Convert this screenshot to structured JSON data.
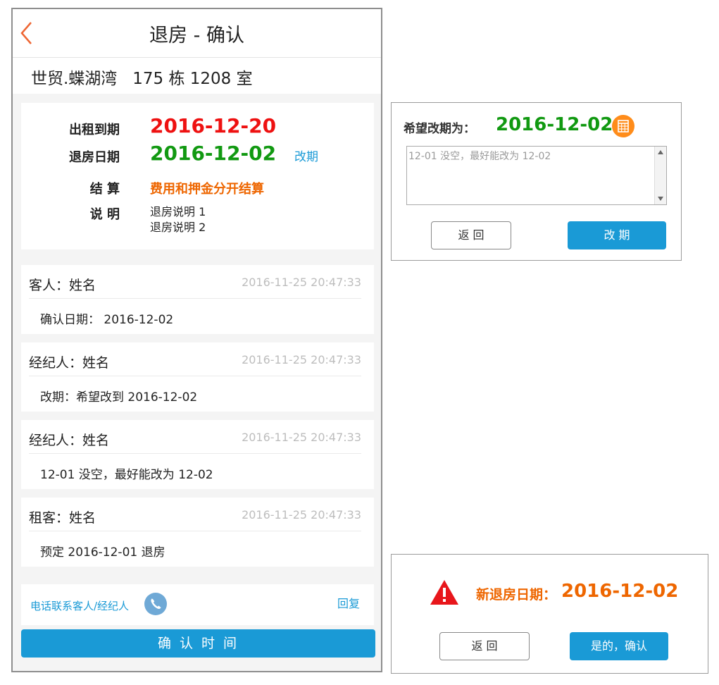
{
  "header": {
    "title": "退房 - 确认"
  },
  "address": "世贸.蝶湖湾   175 栋 1208 室",
  "info": {
    "lease_end_label": "出租到期",
    "lease_end_value": "2016-12-20",
    "checkout_label": "退房日期",
    "checkout_value": "2016-12-02",
    "change_link": "改期",
    "settle_label": "结 算",
    "settle_value": "费用和押金分开结算",
    "note_label": "说 明",
    "notes": [
      "退房说明 1",
      "退房说明 2"
    ]
  },
  "messages": [
    {
      "who": "客人：姓名",
      "time": "2016-11-25 20:47:33",
      "body": "确认日期： 2016-12-02"
    },
    {
      "who": "经纪人：姓名",
      "time": "2016-11-25 20:47:33",
      "body": "改期：希望改到 2016-12-02"
    },
    {
      "who": "经纪人：姓名",
      "time": "2016-11-25 20:47:33",
      "body": "12-01 没空，最好能改为 12-02"
    },
    {
      "who": "租客：姓名",
      "time": "2016-11-25 20:47:33",
      "body": "预定 2016-12-01 退房"
    }
  ],
  "footer": {
    "call_label": "电话联系客人/经纪人",
    "reply_label": "回复"
  },
  "confirm_button": "确 认 时 间",
  "reschedule_dialog": {
    "label": "希望改期为：",
    "date": "2016-12-02",
    "textarea_placeholder": "12-01 没空，最好能改为 12-02",
    "back_button": "返 回",
    "change_button": "改 期"
  },
  "confirm_dialog": {
    "label": "新退房日期：",
    "date": "2016-12-02",
    "back_button": "返 回",
    "yes_button": "是的，确认"
  },
  "colors": {
    "accent": "#1a9ad6",
    "red": "#ee1111",
    "green": "#119911",
    "orange": "#ee6600"
  }
}
